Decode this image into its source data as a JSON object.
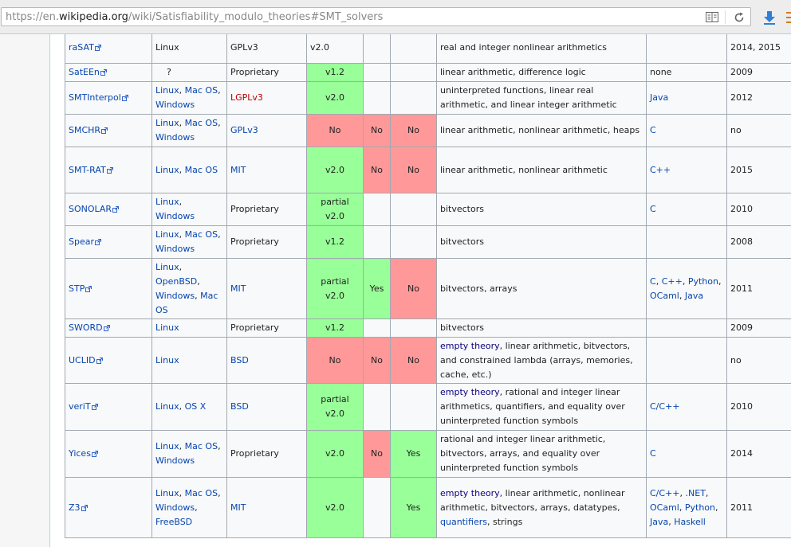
{
  "browser": {
    "url_prefix": "https://en.",
    "url_host": "wikipedia.org",
    "url_path": "/wiki/Satisfiability_modulo_theories#SMT_solvers",
    "icons": {
      "reader": "reader-view-icon",
      "reload": "reload-icon",
      "download": "download-arrow-icon",
      "more": "overflow-menu-icon"
    }
  },
  "colors": {
    "yes": "#99ff99",
    "no": "#ff9999",
    "link": "#0645ad",
    "link_red": "#ba0000"
  },
  "rows": [
    {
      "name": "raSAT",
      "os": [
        {
          "t": "Linux",
          "k": "plain"
        }
      ],
      "license": {
        "t": "GPLv3",
        "k": "plain"
      },
      "smtlib": {
        "t": "v2.0",
        "k": "plain"
      },
      "c4": {
        "t": "",
        "k": "plain"
      },
      "c5": {
        "t": "",
        "k": "plain"
      },
      "theories": [
        {
          "t": "real and integer nonlinear arithmetics",
          "k": "plain"
        }
      ],
      "api": [],
      "year": "2014, 2015"
    },
    {
      "name": "SatEEn",
      "os": [
        {
          "t": "?",
          "k": "plain"
        }
      ],
      "license": {
        "t": "Proprietary",
        "k": "plain"
      },
      "smtlib": {
        "t": "v1.2",
        "k": "yes"
      },
      "c4": {
        "t": "",
        "k": "plain"
      },
      "c5": {
        "t": "",
        "k": "plain"
      },
      "theories": [
        {
          "t": "linear arithmetic, difference logic",
          "k": "plain"
        }
      ],
      "api": [
        {
          "t": "none",
          "k": "plain"
        }
      ],
      "year": "2009"
    },
    {
      "name": "SMTInterpol",
      "os": [
        {
          "t": "Linux",
          "k": "link"
        },
        {
          "t": ", ",
          "k": "plain"
        },
        {
          "t": "Mac OS",
          "k": "link"
        },
        {
          "t": ", ",
          "k": "plain"
        },
        {
          "t": "Windows",
          "k": "link"
        }
      ],
      "license": {
        "t": "LGPLv3",
        "k": "red"
      },
      "smtlib": {
        "t": "v2.0",
        "k": "yes"
      },
      "c4": {
        "t": "",
        "k": "plain"
      },
      "c5": {
        "t": "",
        "k": "plain"
      },
      "theories": [
        {
          "t": "uninterpreted functions, linear real arithmetic, and linear integer arithmetic",
          "k": "plain"
        }
      ],
      "api": [
        {
          "t": "Java",
          "k": "link"
        }
      ],
      "year": "2012"
    },
    {
      "name": "SMCHR",
      "os": [
        {
          "t": "Linux",
          "k": "link"
        },
        {
          "t": ", ",
          "k": "plain"
        },
        {
          "t": "Mac OS",
          "k": "link"
        },
        {
          "t": ", ",
          "k": "plain"
        },
        {
          "t": "Windows",
          "k": "link"
        }
      ],
      "license": {
        "t": "GPLv3",
        "k": "link"
      },
      "smtlib": {
        "t": "No",
        "k": "no"
      },
      "c4": {
        "t": "No",
        "k": "no"
      },
      "c5": {
        "t": "No",
        "k": "no"
      },
      "theories": [
        {
          "t": "linear arithmetic, nonlinear arithmetic, heaps",
          "k": "plain"
        }
      ],
      "api": [
        {
          "t": "C",
          "k": "link"
        }
      ],
      "year": "no"
    },
    {
      "name": "SMT-RAT",
      "os": [
        {
          "t": "Linux",
          "k": "link"
        },
        {
          "t": ", ",
          "k": "plain"
        },
        {
          "t": "Mac OS",
          "k": "link"
        }
      ],
      "license": {
        "t": "MIT",
        "k": "link"
      },
      "smtlib": {
        "t": "v2.0",
        "k": "yes"
      },
      "c4": {
        "t": "No",
        "k": "no"
      },
      "c5": {
        "t": "No",
        "k": "no"
      },
      "theories": [
        {
          "t": "linear arithmetic, nonlinear arithmetic",
          "k": "plain"
        }
      ],
      "api": [
        {
          "t": "C++",
          "k": "link"
        }
      ],
      "year": "2015"
    },
    {
      "name": "SONOLAR",
      "os": [
        {
          "t": "Linux",
          "k": "link"
        },
        {
          "t": ", ",
          "k": "plain"
        },
        {
          "t": "Windows",
          "k": "link"
        }
      ],
      "license": {
        "t": "Proprietary",
        "k": "plain"
      },
      "smtlib": {
        "t": "partial v2.0",
        "k": "yes"
      },
      "c4": {
        "t": "",
        "k": "plain"
      },
      "c5": {
        "t": "",
        "k": "plain"
      },
      "theories": [
        {
          "t": "bitvectors",
          "k": "plain"
        }
      ],
      "api": [
        {
          "t": "C",
          "k": "link"
        }
      ],
      "year": "2010"
    },
    {
      "name": "Spear",
      "os": [
        {
          "t": "Linux",
          "k": "link"
        },
        {
          "t": ", ",
          "k": "plain"
        },
        {
          "t": "Mac OS",
          "k": "link"
        },
        {
          "t": ", ",
          "k": "plain"
        },
        {
          "t": "Windows",
          "k": "link"
        }
      ],
      "license": {
        "t": "Proprietary",
        "k": "plain"
      },
      "smtlib": {
        "t": "v1.2",
        "k": "yes"
      },
      "c4": {
        "t": "",
        "k": "plain"
      },
      "c5": {
        "t": "",
        "k": "plain"
      },
      "theories": [
        {
          "t": "bitvectors",
          "k": "plain"
        }
      ],
      "api": [],
      "year": "2008"
    },
    {
      "name": "STP",
      "os": [
        {
          "t": "Linux",
          "k": "link"
        },
        {
          "t": ", ",
          "k": "plain"
        },
        {
          "t": "OpenBSD",
          "k": "link"
        },
        {
          "t": ", ",
          "k": "plain"
        },
        {
          "t": "Windows",
          "k": "link"
        },
        {
          "t": ", ",
          "k": "plain"
        },
        {
          "t": "Mac OS",
          "k": "link"
        }
      ],
      "license": {
        "t": "MIT",
        "k": "link"
      },
      "smtlib": {
        "t": "partial v2.0",
        "k": "yes"
      },
      "c4": {
        "t": "Yes",
        "k": "yes"
      },
      "c5": {
        "t": "No",
        "k": "no"
      },
      "theories": [
        {
          "t": "bitvectors, arrays",
          "k": "plain"
        }
      ],
      "api": [
        {
          "t": "C",
          "k": "link"
        },
        {
          "t": ", ",
          "k": "plain"
        },
        {
          "t": "C++",
          "k": "link"
        },
        {
          "t": ", ",
          "k": "plain"
        },
        {
          "t": "Python",
          "k": "link"
        },
        {
          "t": ", ",
          "k": "plain"
        },
        {
          "t": "OCaml",
          "k": "link"
        },
        {
          "t": ", ",
          "k": "plain"
        },
        {
          "t": "Java",
          "k": "link"
        }
      ],
      "year": "2011"
    },
    {
      "name": "SWORD",
      "os": [
        {
          "t": "Linux",
          "k": "link"
        }
      ],
      "license": {
        "t": "Proprietary",
        "k": "plain"
      },
      "smtlib": {
        "t": "v1.2",
        "k": "yes"
      },
      "c4": {
        "t": "",
        "k": "plain"
      },
      "c5": {
        "t": "",
        "k": "plain"
      },
      "theories": [
        {
          "t": "bitvectors",
          "k": "plain"
        }
      ],
      "api": [],
      "year": "2009"
    },
    {
      "name": "UCLID",
      "os": [
        {
          "t": "Linux",
          "k": "link"
        }
      ],
      "license": {
        "t": "BSD",
        "k": "link"
      },
      "smtlib": {
        "t": "No",
        "k": "no"
      },
      "c4": {
        "t": "No",
        "k": "no"
      },
      "c5": {
        "t": "No",
        "k": "no"
      },
      "theories": [
        {
          "t": "empty theory",
          "k": "dark"
        },
        {
          "t": ", linear arithmetic, bitvectors, and constrained lambda (arrays, memories, cache, etc.)",
          "k": "plain"
        }
      ],
      "api": [],
      "year": "no"
    },
    {
      "name": "veriT",
      "os": [
        {
          "t": "Linux",
          "k": "link"
        },
        {
          "t": ", ",
          "k": "plain"
        },
        {
          "t": "OS X",
          "k": "link"
        }
      ],
      "license": {
        "t": "BSD",
        "k": "link"
      },
      "smtlib": {
        "t": "partial v2.0",
        "k": "yes"
      },
      "c4": {
        "t": "",
        "k": "plain"
      },
      "c5": {
        "t": "",
        "k": "plain"
      },
      "theories": [
        {
          "t": "empty theory",
          "k": "dark"
        },
        {
          "t": ", rational and integer linear arithmetics, quantifiers, and equality over uninterpreted function symbols",
          "k": "plain"
        }
      ],
      "api": [
        {
          "t": "C/C++",
          "k": "link"
        }
      ],
      "year": "2010"
    },
    {
      "name": "Yices",
      "os": [
        {
          "t": "Linux",
          "k": "link"
        },
        {
          "t": ", ",
          "k": "plain"
        },
        {
          "t": "Mac OS",
          "k": "link"
        },
        {
          "t": ", ",
          "k": "plain"
        },
        {
          "t": "Windows",
          "k": "link"
        }
      ],
      "license": {
        "t": "Proprietary",
        "k": "plain"
      },
      "smtlib": {
        "t": "v2.0",
        "k": "yes"
      },
      "c4": {
        "t": "No",
        "k": "no"
      },
      "c5": {
        "t": "Yes",
        "k": "yes"
      },
      "theories": [
        {
          "t": "rational and integer linear arithmetic, bitvectors, arrays, and equality over uninterpreted function symbols",
          "k": "plain"
        }
      ],
      "api": [
        {
          "t": "C",
          "k": "link"
        }
      ],
      "year": "2014"
    },
    {
      "name": "Z3",
      "os": [
        {
          "t": "Linux",
          "k": "link"
        },
        {
          "t": ", ",
          "k": "plain"
        },
        {
          "t": "Mac OS",
          "k": "link"
        },
        {
          "t": ", ",
          "k": "plain"
        },
        {
          "t": "Windows",
          "k": "link"
        },
        {
          "t": ", ",
          "k": "plain"
        },
        {
          "t": "FreeBSD",
          "k": "link"
        }
      ],
      "license": {
        "t": "MIT",
        "k": "link"
      },
      "smtlib": {
        "t": "v2.0",
        "k": "yes"
      },
      "c4": {
        "t": "",
        "k": "plain"
      },
      "c5": {
        "t": "Yes",
        "k": "yes"
      },
      "theories": [
        {
          "t": "empty theory",
          "k": "dark"
        },
        {
          "t": ", linear arithmetic, nonlinear arithmetic, bitvectors, arrays, datatypes, ",
          "k": "plain"
        },
        {
          "t": "quantifiers",
          "k": "link"
        },
        {
          "t": ", strings",
          "k": "plain"
        }
      ],
      "api": [
        {
          "t": "C/C++",
          "k": "link"
        },
        {
          "t": ", ",
          "k": "plain"
        },
        {
          "t": ".NET",
          "k": "link"
        },
        {
          "t": ", ",
          "k": "plain"
        },
        {
          "t": "OCaml",
          "k": "link"
        },
        {
          "t": ", ",
          "k": "plain"
        },
        {
          "t": "Python",
          "k": "link"
        },
        {
          "t": ", ",
          "k": "plain"
        },
        {
          "t": "Java",
          "k": "link"
        },
        {
          "t": ", ",
          "k": "plain"
        },
        {
          "t": "Haskell",
          "k": "link"
        }
      ],
      "year": "2011"
    }
  ]
}
